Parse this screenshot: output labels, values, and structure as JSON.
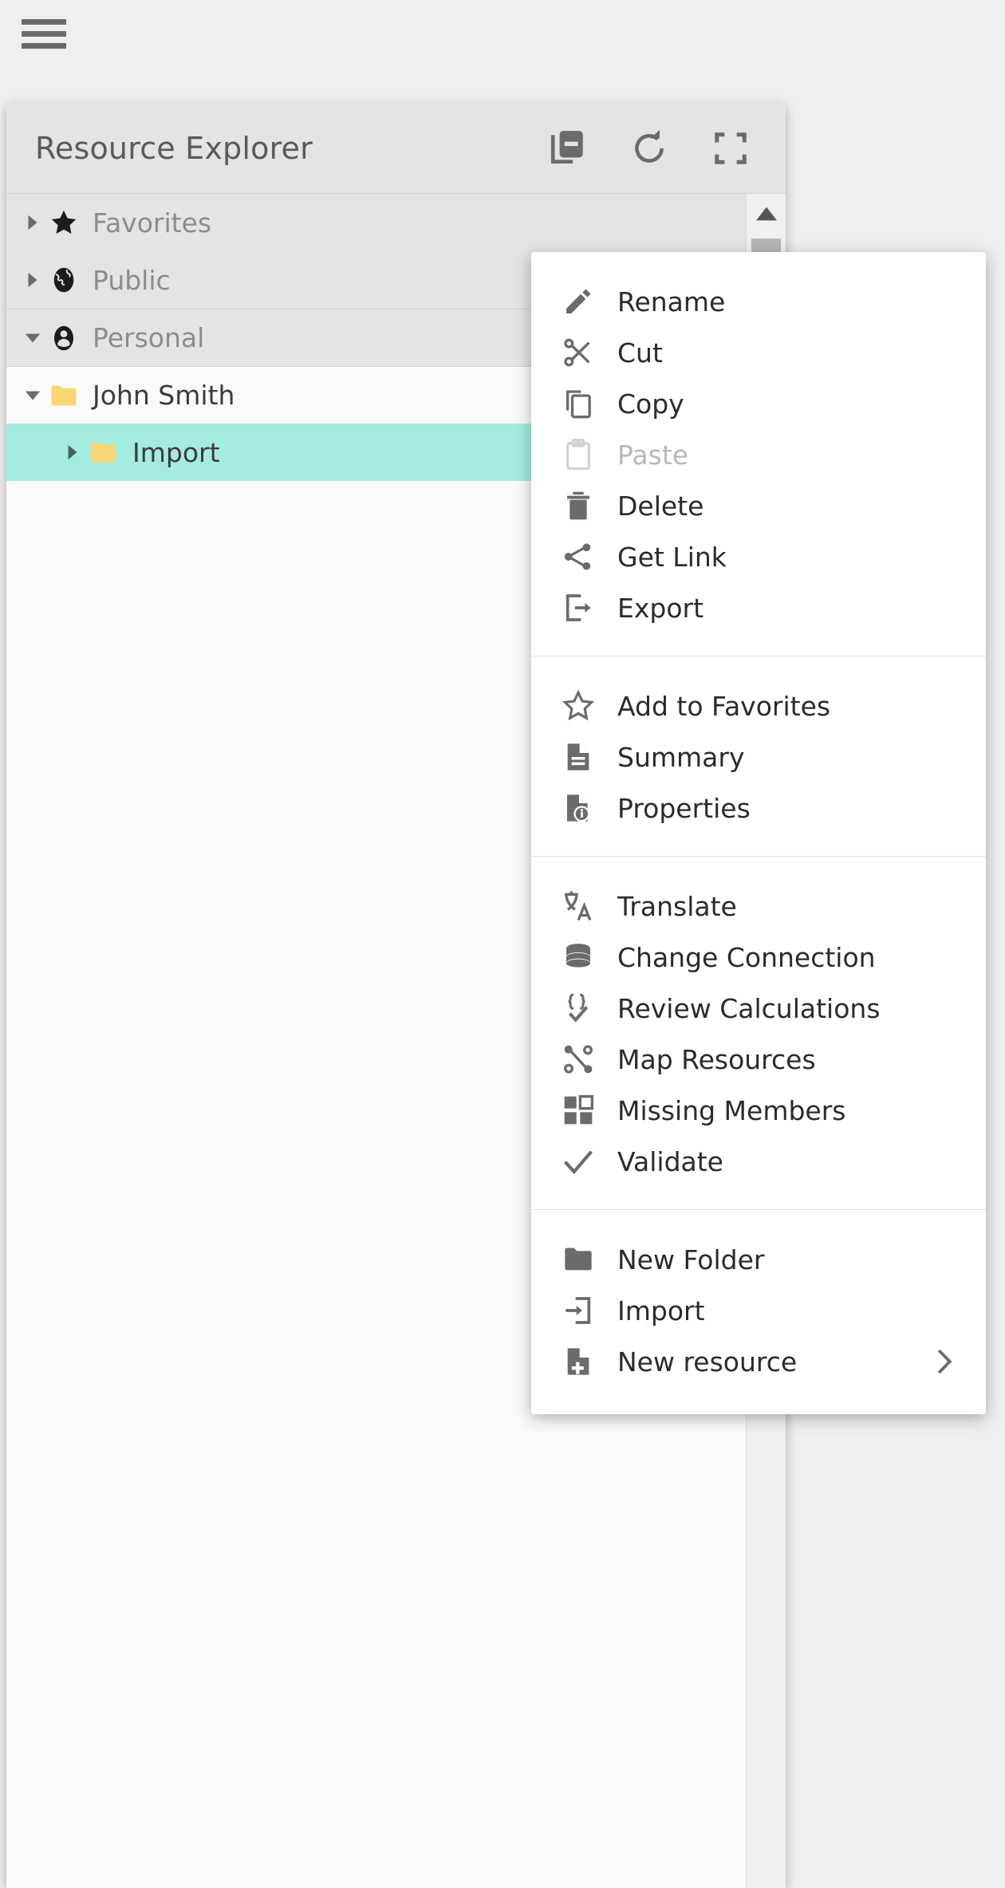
{
  "app": {
    "menu_button_icon": "hamburger-icon"
  },
  "panel": {
    "title": "Resource Explorer",
    "actions": [
      {
        "icon": "collapse-all-icon",
        "name": "collapse-all-button"
      },
      {
        "icon": "refresh-icon",
        "name": "refresh-button"
      },
      {
        "icon": "fullscreen-icon",
        "name": "fullscreen-button"
      }
    ],
    "scrollbar": {
      "up_arrow_icon": "scroll-up-arrow-icon"
    }
  },
  "tree": {
    "items": [
      {
        "label": "Favorites",
        "icon": "star-icon",
        "level": 0,
        "expanded": false,
        "selected": false
      },
      {
        "label": "Public",
        "icon": "globe-icon",
        "level": 0,
        "expanded": false,
        "selected": false
      },
      {
        "label": "Personal",
        "icon": "person-icon",
        "level": 0,
        "expanded": true,
        "selected": false
      },
      {
        "label": "John Smith",
        "icon": "folder-icon",
        "level": 1,
        "expanded": true,
        "selected": false
      },
      {
        "label": "Import",
        "icon": "folder-icon",
        "level": 2,
        "expanded": false,
        "selected": true
      }
    ]
  },
  "context_menu": {
    "sections": [
      {
        "items": [
          {
            "label": "Rename",
            "icon": "pencil-icon",
            "disabled": false,
            "submenu": false
          },
          {
            "label": "Cut",
            "icon": "scissors-icon",
            "disabled": false,
            "submenu": false
          },
          {
            "label": "Copy",
            "icon": "copy-icon",
            "disabled": false,
            "submenu": false
          },
          {
            "label": "Paste",
            "icon": "clipboard-icon",
            "disabled": true,
            "submenu": false
          },
          {
            "label": "Delete",
            "icon": "trash-icon",
            "disabled": false,
            "submenu": false
          },
          {
            "label": "Get Link",
            "icon": "share-icon",
            "disabled": false,
            "submenu": false
          },
          {
            "label": "Export",
            "icon": "export-icon",
            "disabled": false,
            "submenu": false
          }
        ]
      },
      {
        "items": [
          {
            "label": "Add to Favorites",
            "icon": "star-outline-icon",
            "disabled": false,
            "submenu": false
          },
          {
            "label": "Summary",
            "icon": "document-icon",
            "disabled": false,
            "submenu": false
          },
          {
            "label": "Properties",
            "icon": "document-info-icon",
            "disabled": false,
            "submenu": false
          }
        ]
      },
      {
        "items": [
          {
            "label": "Translate",
            "icon": "translate-icon",
            "disabled": false,
            "submenu": false
          },
          {
            "label": "Change Connection",
            "icon": "database-icon",
            "disabled": false,
            "submenu": false
          },
          {
            "label": "Review Calculations",
            "icon": "braces-check-icon",
            "disabled": false,
            "submenu": false
          },
          {
            "label": "Map Resources",
            "icon": "graph-nodes-icon",
            "disabled": false,
            "submenu": false
          },
          {
            "label": "Missing Members",
            "icon": "grid-squares-icon",
            "disabled": false,
            "submenu": false
          },
          {
            "label": "Validate",
            "icon": "checkmark-icon",
            "disabled": false,
            "submenu": false
          }
        ]
      },
      {
        "items": [
          {
            "label": "New Folder",
            "icon": "folder-solid-icon",
            "disabled": false,
            "submenu": false
          },
          {
            "label": "Import",
            "icon": "import-icon",
            "disabled": false,
            "submenu": false
          },
          {
            "label": "New resource",
            "icon": "document-plus-icon",
            "disabled": false,
            "submenu": true
          }
        ]
      }
    ],
    "submenu_chevron_icon": "chevron-right-icon"
  },
  "colors": {
    "background": "#efefef",
    "panel_header": "#e4e4e4",
    "selection_teal": "#a5ece0",
    "folder_yellow": "#f7d775",
    "icon_grey": "#6b6b6b",
    "text_dark": "#2b2b2b",
    "text_muted": "#8c8c8c",
    "disabled_grey": "#b8b8b8"
  }
}
